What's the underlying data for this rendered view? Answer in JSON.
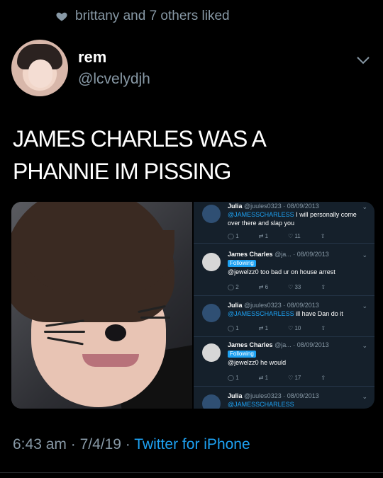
{
  "liked_line": "brittany and 7 others liked",
  "author": {
    "name": "rem",
    "handle": "@lcvelydjh"
  },
  "tweet": {
    "text_line1": "JAMES CHARLES WAS A",
    "text_line2": "PHANNIE IM PISSING"
  },
  "embedded": [
    {
      "name": "Julia",
      "meta": "@juules0323 · 08/09/2013",
      "mention": "@JAMESSCHARLESS",
      "text": "I will personally come over there and slap you",
      "following": "",
      "stats": [
        "1",
        "1",
        "11",
        ""
      ]
    },
    {
      "name": "James Charles",
      "meta": "@ja... · 08/09/2013",
      "mention": "",
      "text": "@jewelzz0 too bad ur on house arrest",
      "following": "Following",
      "stats": [
        "2",
        "6",
        "33",
        ""
      ]
    },
    {
      "name": "Julia",
      "meta": "@juules0323 · 08/09/2013",
      "mention": "@JAMESSCHARLESS",
      "text": "ill have Dan do it",
      "following": "",
      "stats": [
        "1",
        "1",
        "10",
        ""
      ]
    },
    {
      "name": "James Charles",
      "meta": "@ja... · 08/09/2013",
      "mention": "",
      "text": "@jewelzz0 he would",
      "following": "Following",
      "stats": [
        "1",
        "1",
        "17",
        ""
      ]
    },
    {
      "name": "Julia",
      "meta": "@juules0323 · 08/09/2013",
      "mention": "@JAMESSCHARLESS",
      "text": "",
      "following": "",
      "stats": [
        "",
        "",
        "",
        ""
      ]
    }
  ],
  "footer": {
    "time": "6:43 am",
    "date": "7/4/19",
    "separator": " · ",
    "source": "Twitter for iPhone"
  },
  "colors": {
    "background": "#000000",
    "muted": "#8899a6",
    "accent": "#1da1f2",
    "embed_bg": "#15202b"
  },
  "icons": [
    "heart-icon",
    "chevron-down-icon",
    "reply-icon",
    "retweet-icon",
    "like-icon",
    "share-icon"
  ]
}
